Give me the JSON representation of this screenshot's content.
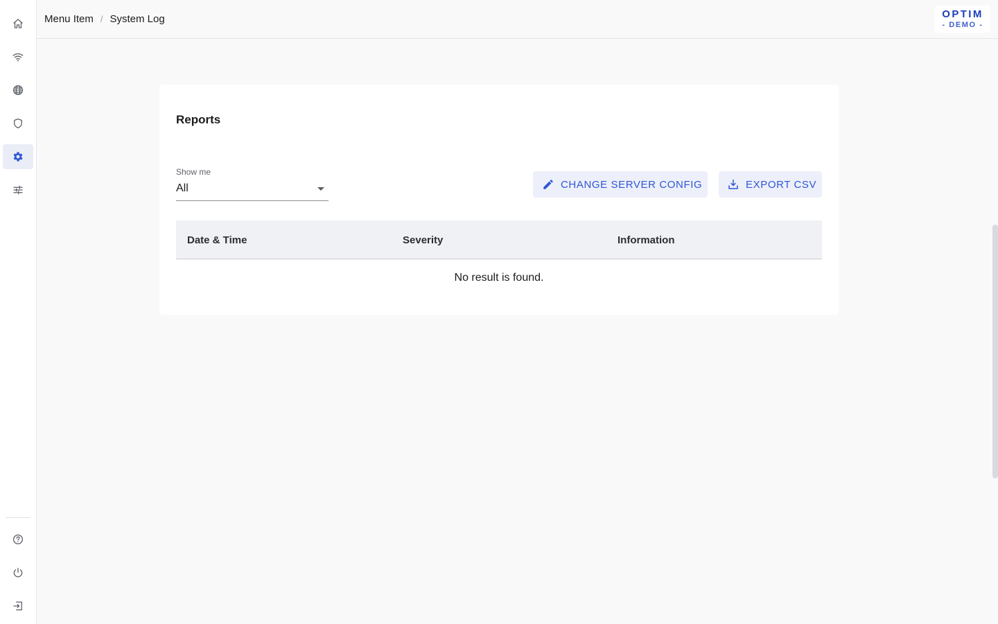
{
  "sidebar": {
    "items": [
      {
        "icon": "home-icon"
      },
      {
        "icon": "wifi-icon"
      },
      {
        "icon": "globe-icon"
      },
      {
        "icon": "shield-icon"
      },
      {
        "icon": "gear-icon",
        "active": true
      },
      {
        "icon": "sliders-icon"
      }
    ],
    "bottom_items": [
      {
        "icon": "help-icon"
      },
      {
        "icon": "power-icon"
      },
      {
        "icon": "logout-icon"
      }
    ]
  },
  "header": {
    "breadcrumb": [
      "Menu Item",
      "System Log"
    ],
    "breadcrumb_separator": "/",
    "logo": {
      "word": "OPTIM",
      "subtitle": "- DEMO -"
    }
  },
  "card": {
    "title": "Reports",
    "filter": {
      "label": "Show me",
      "value": "All"
    },
    "buttons": {
      "change_config": "CHANGE SERVER CONFIG",
      "export_csv": "EXPORT CSV"
    },
    "table": {
      "columns": [
        "Date & Time",
        "Severity",
        "Information"
      ],
      "rows": [],
      "empty_message": "No result is found."
    }
  },
  "colors": {
    "accent": "#2f56d4",
    "brand": "#1c3fb8",
    "background": "#f9f9fa",
    "card": "#ffffff",
    "table_header": "#f0f1f5"
  }
}
